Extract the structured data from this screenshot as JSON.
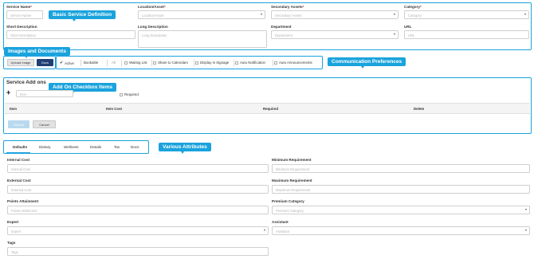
{
  "basic": {
    "service_name": {
      "label": "Service Name",
      "placeholder": "Service Name"
    },
    "location_asset": {
      "label": "Location/Asset",
      "placeholder": "Location/Asset"
    },
    "secondary_assets": {
      "label": "Secondary Assets",
      "placeholder": "Secondary Assets"
    },
    "category": {
      "label": "Category",
      "placeholder": "Category"
    },
    "short_description": {
      "label": "Short Description",
      "placeholder": "Short Description"
    },
    "long_description": {
      "label": "Long Description",
      "placeholder": "Long Description"
    },
    "department": {
      "label": "Department",
      "placeholder": "Department"
    },
    "url": {
      "label": "URL",
      "placeholder": "URL"
    },
    "required_marker": "*"
  },
  "callouts": {
    "basic": "Basic Service Definition",
    "images": "Images and Documents",
    "communication": "Communication Preferences",
    "addon": "Add On Checkbox Items",
    "attributes": "Various Attributes"
  },
  "toolbar": {
    "upload_image": "Upload Image",
    "docs": "Docs",
    "options": [
      "Active",
      "Bookable",
      "All",
      "Waiting List",
      "Share to Calendars",
      "Display in Signage",
      "Auto Notification",
      "Auto Announcements"
    ],
    "active_check": "✔"
  },
  "addons": {
    "title": "Service Add ons",
    "add_icon": "+",
    "item_placeholder": "Item",
    "required_label": "Required",
    "columns": [
      "Item",
      "Item Cost",
      "Required",
      "Delete"
    ],
    "submit": "Submit",
    "cancel": "Cancel"
  },
  "tabs": [
    "Defaults",
    "Dietary",
    "Wellness",
    "Details",
    "Tax",
    "Docs"
  ],
  "attributes": {
    "internal_cost": {
      "label": "Internal Cost",
      "placeholder": "Internal Cost"
    },
    "minimum_requirement": {
      "label": "Minimum Requirement",
      "placeholder": "Minimum Requirement"
    },
    "external_cost": {
      "label": "External Cost",
      "placeholder": "External Cost"
    },
    "maximum_requirement": {
      "label": "Maximum Requirement",
      "placeholder": "Maximum Requirement"
    },
    "points_attainment": {
      "label": "Points Attainment",
      "placeholder": "Points Attainment"
    },
    "premium_category": {
      "label": "Premium Category",
      "placeholder": "Premium Category"
    },
    "expert": {
      "label": "Expert",
      "placeholder": "Expert"
    },
    "assistant": {
      "label": "Assistant",
      "placeholder": "Assistant"
    },
    "tags": {
      "label": "Tags",
      "placeholder": "Tags"
    }
  },
  "colors": {
    "accent": "#1aa3dd",
    "docs_button": "#1f3f74",
    "submit_button": "#b9d9ef"
  }
}
